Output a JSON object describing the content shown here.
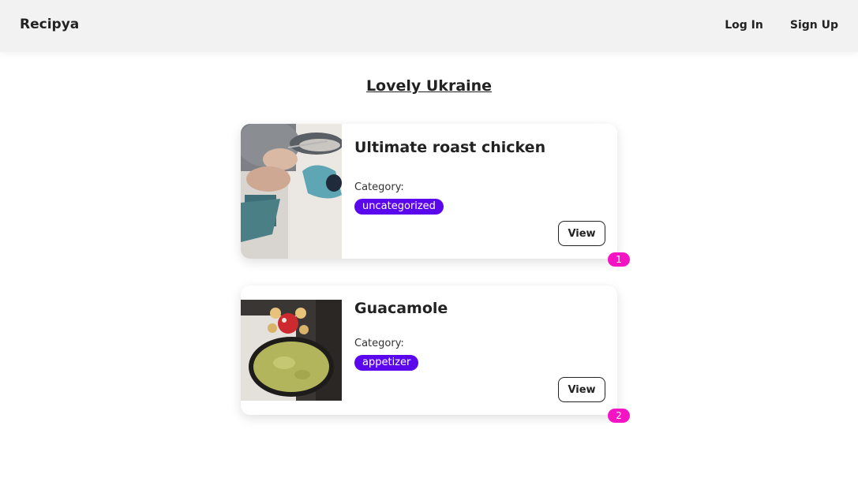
{
  "navbar": {
    "brand": "Recipya",
    "login_label": "Log In",
    "signup_label": "Sign Up"
  },
  "page": {
    "title": "Lovely Ukraine"
  },
  "recipes": [
    {
      "title": "Ultimate roast chicken",
      "category_label": "Category:",
      "category": "uncategorized",
      "view_label": "View",
      "index": "1"
    },
    {
      "title": "Guacamole",
      "category_label": "Category:",
      "category": "appetizer",
      "view_label": "View",
      "index": "2"
    }
  ],
  "colors": {
    "navbar_bg": "#f2f2f3",
    "category_badge": "#5b07ee",
    "index_badge": "#f414c4"
  }
}
